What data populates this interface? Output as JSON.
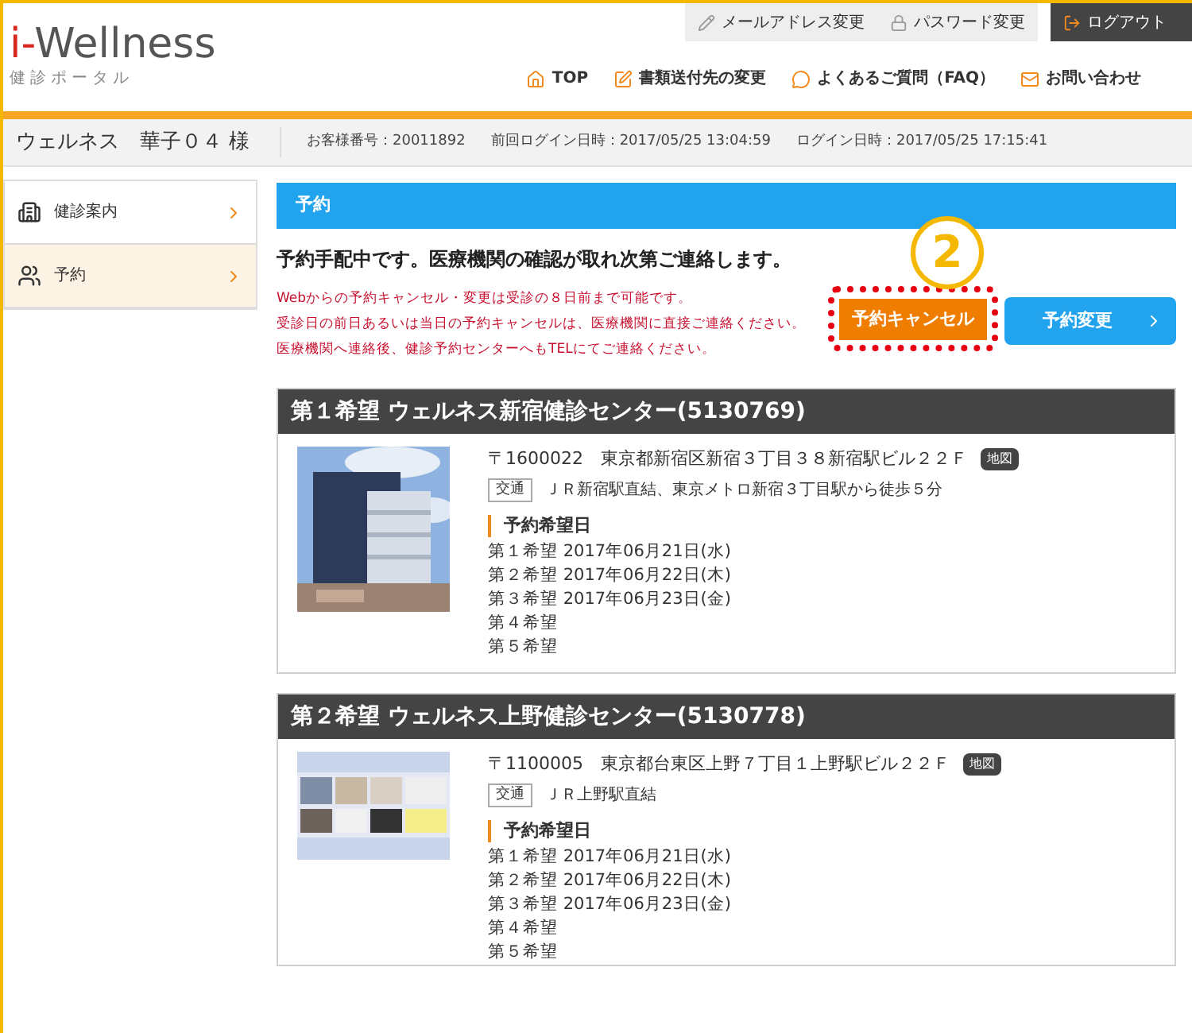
{
  "header": {
    "logo": "i-Wellness",
    "logo_subtitle": "健診ポータル",
    "account_links": [
      {
        "label": "メールアドレス変更",
        "kind": "mail"
      },
      {
        "label": "パスワード変更",
        "kind": "password"
      },
      {
        "label": "ログアウト",
        "kind": "logout"
      }
    ],
    "nav": [
      {
        "label": "TOP",
        "kind": "home"
      },
      {
        "label": "書類送付先の変更",
        "kind": "edit"
      },
      {
        "label": "よくあるご質問（FAQ）",
        "kind": "faq"
      },
      {
        "label": "お問い合わせ",
        "kind": "contact"
      }
    ]
  },
  "user_bar": {
    "name": "ウェルネス　華子０４ 様",
    "customer_number": "お客様番号：20011892",
    "last_login": "前回ログイン日時：2017/05/25 13:04:59",
    "login": "ログイン日時：2017/05/25 17:15:41"
  },
  "sidebar": {
    "items": [
      {
        "label": "健診案内",
        "kind": "building",
        "selected": false
      },
      {
        "label": "予約",
        "kind": "people",
        "selected": true
      }
    ]
  },
  "main": {
    "section_title": "予約",
    "message": "予約手配中です。医療機関の確認が取れ次第ご連絡します。",
    "notes": [
      "Webからの予約キャンセル・変更は受診の８日前まで可能です。",
      "受診日の前日あるいは当日の予約キャンセルは、医療機関に直接ご連絡ください。",
      "医療機関へ連絡後、健診予約センターへもTELにてご連絡ください。"
    ],
    "annotation": "2",
    "cancel_button": "予約キャンセル",
    "change_button": "予約変更",
    "centers": [
      {
        "title": "第１希望 ウェルネス新宿健診センター(5130769)",
        "address": "〒1600022　東京都新宿区新宿３丁目３８新宿駅ビル２２Ｆ",
        "map": "地図",
        "access_label": "交通",
        "access": "ＪＲ新宿駅直結、東京メトロ新宿３丁目駅から徒歩５分",
        "dates_title": "予約希望日",
        "dates": [
          "第１希望 2017年06月21日(水)",
          "第２希望 2017年06月22日(木)",
          "第３希望 2017年06月23日(金)",
          "第４希望",
          "第５希望"
        ]
      },
      {
        "title": "第２希望 ウェルネス上野健診センター(5130778)",
        "address": "〒1100005　東京都台東区上野７丁目１上野駅ビル２２Ｆ",
        "map": "地図",
        "access_label": "交通",
        "access": "ＪＲ上野駅直結",
        "dates_title": "予約希望日",
        "dates": [
          "第１希望 2017年06月21日(水)",
          "第２希望 2017年06月22日(木)",
          "第３希望 2017年06月23日(金)",
          "第４希望",
          "第５希望"
        ]
      }
    ]
  }
}
